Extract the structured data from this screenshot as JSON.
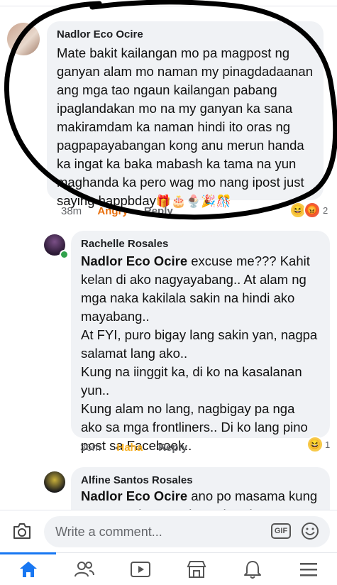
{
  "comments": [
    {
      "author": "Nadlor Eco Ocire",
      "text": "Mate bakit kailangan mo pa magpost ng\nganyan alam mo naman my pinagdadaanan\nang mga tao ngaun kailangan pabang\nipaglandakan mo na my ganyan ka sana\nmakiramdam ka naman hindi ito oras ng\npagpapayabangan kong anu merun handa\nka ingat ka baka mabash ka tama na yun\nmaghanda ka pero wag mo nang ipost just\nsaying happbday",
      "trailing_emojis": "🎁🎂🍨🎉🎊",
      "time": "38m",
      "reaction_label": "Angry",
      "reply_label": "Reply",
      "reaction_count": "2"
    },
    {
      "author": "Rachelle Rosales",
      "mention": "Nadlor Eco Ocire",
      "text": " excuse me??? Kahit\nkelan di ako nagyayabang.. At alam ng\nmga naka kakilala sakin na hindi ako\nmayabang..\nAt FYI, puro bigay lang sakin yan, nagpa\nsalamat lang ako..\nKung na iinggit ka, di ko na kasalanan\nyun..\nKung alam no lang, nagbigay pa nga\nako sa mga frontliners.. Di ko lang pino\npost sa Facebook..",
      "time": "36m",
      "reaction_label": "Haha",
      "reply_label": "Reply",
      "reaction_count": "1"
    },
    {
      "author": "Alfine Santos Rosales",
      "mention": "Nadlor Eco Ocire",
      "text": " ano po masama kung\nmag post lmo na pics at handa nya?"
    }
  ],
  "composer": {
    "placeholder": "Write a comment...",
    "gif_label": "GIF"
  },
  "nav": {
    "items": [
      "home-icon",
      "friends-icon",
      "watch-icon",
      "marketplace-icon",
      "notifications-icon",
      "menu-icon"
    ],
    "active": "home-icon"
  },
  "colors": {
    "accent": "#1877f2",
    "reaction_text": "#f7b125",
    "bubble": "#f0f2f5"
  }
}
